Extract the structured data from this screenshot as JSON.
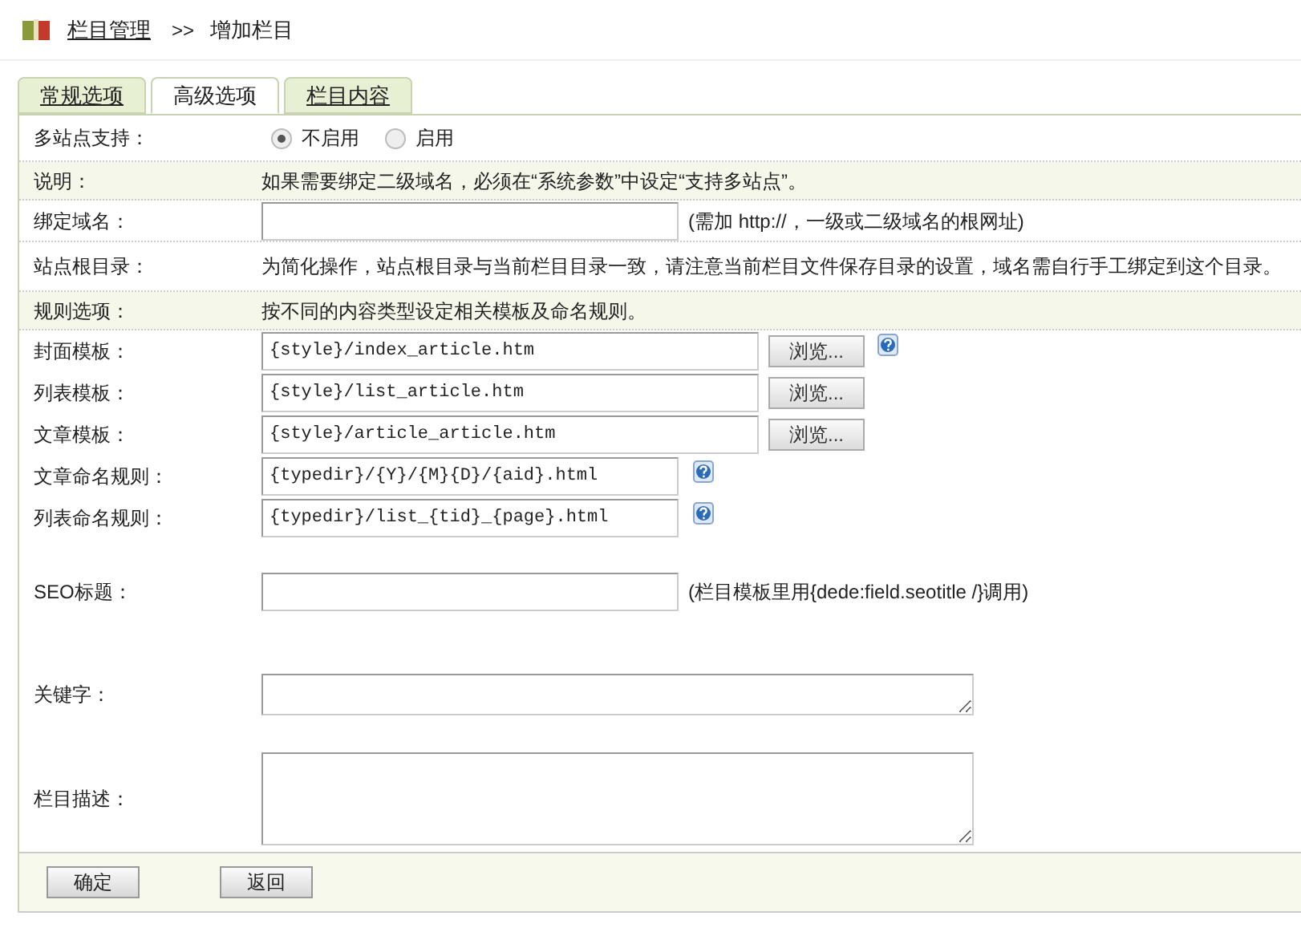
{
  "breadcrumb": {
    "link": "栏目管理",
    "separator": ">>",
    "current": "增加栏目"
  },
  "tabs": [
    {
      "label": "常规选项",
      "selected": false
    },
    {
      "label": "高级选项",
      "selected": true
    },
    {
      "label": "栏目内容",
      "selected": false
    }
  ],
  "rows": [
    {
      "kind": "radio",
      "label": "多站点支持：",
      "options": [
        {
          "label": "不启用",
          "selected": true
        },
        {
          "label": "启用",
          "selected": false
        }
      ]
    },
    {
      "kind": "note",
      "label": "说明：",
      "text": "如果需要绑定二级域名，必须在“系统参数”中设定“支持多站点”。"
    },
    {
      "kind": "field",
      "label": "绑定域名：",
      "hint": "(需加 http://，一级或二级域名的根网址)"
    },
    {
      "kind": "info",
      "label": "站点根目录：",
      "text": "为简化操作，站点根目录与当前栏目目录一致，请注意当前栏目文件保存目录的设置，域名需自行手工绑定到这个目录。"
    },
    {
      "kind": "note",
      "label": "规则选项：",
      "text": "按不同的内容类型设定相关模板及命名规则。"
    },
    {
      "kind": "template",
      "label": "封面模板：",
      "value": "{style}/index_article.htm",
      "button": "浏览...",
      "help": true
    },
    {
      "kind": "template",
      "label": "列表模板：",
      "value": "{style}/list_article.htm",
      "button": "浏览...",
      "help": false
    },
    {
      "kind": "template",
      "label": "文章模板：",
      "value": "{style}/article_article.htm",
      "button": "浏览...",
      "help": false
    },
    {
      "kind": "rule",
      "label": "文章命名规则：",
      "value": "{typedir}/{Y}/{M}{D}/{aid}.html",
      "help": true
    },
    {
      "kind": "rule",
      "label": "列表命名规则：",
      "value": "{typedir}/list_{tid}_{page}.html",
      "help": true
    },
    {
      "kind": "seo",
      "label": "SEO标题：",
      "hint": "(栏目模板里用{dede:field.seotitle /}调用)"
    },
    {
      "kind": "memo",
      "label": "关键字："
    },
    {
      "kind": "textarea",
      "label": "栏目描述："
    }
  ],
  "buttons": [
    "确定",
    "返回"
  ]
}
